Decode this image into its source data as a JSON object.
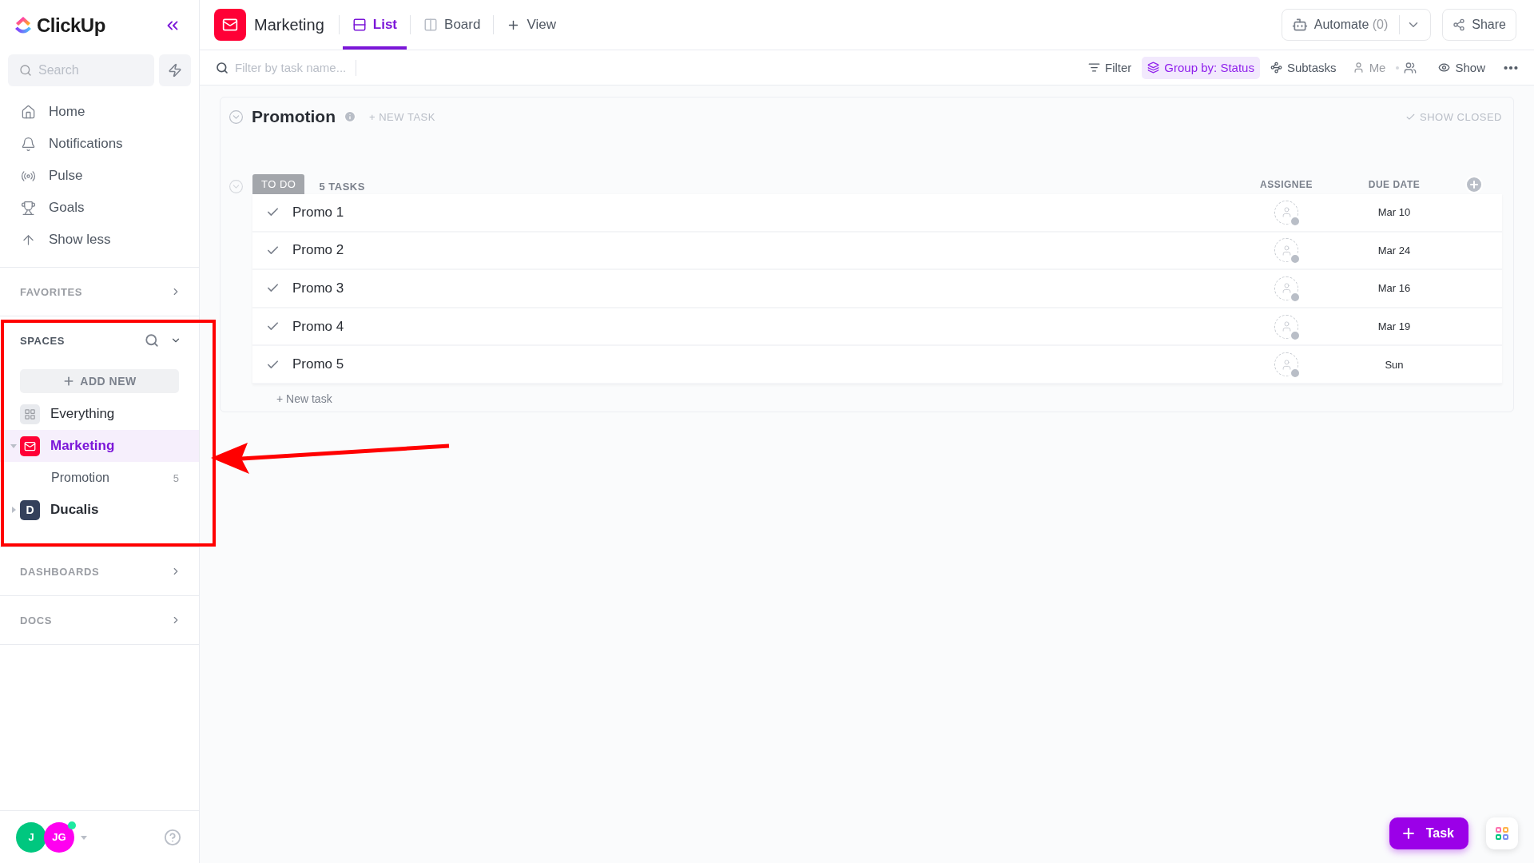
{
  "sidebar": {
    "logo": "ClickUp",
    "search": {
      "placeholder": "Search"
    },
    "nav": [
      {
        "label": "Home",
        "kind": "home"
      },
      {
        "label": "Notifications",
        "kind": "bell"
      },
      {
        "label": "Pulse",
        "kind": "pulse"
      },
      {
        "label": "Goals",
        "kind": "trophy"
      },
      {
        "label": "Show less",
        "kind": "up"
      }
    ],
    "favorites": "FAVORITES",
    "spaces": {
      "title": "SPACES",
      "add_new": "ADD NEW",
      "items": [
        {
          "label": "Everything",
          "kind": "all",
          "selected": false
        },
        {
          "label": "Marketing",
          "kind": "space",
          "selected": true,
          "expanded": true,
          "color": "#ff0036",
          "children": [
            {
              "label": "Promotion",
              "count": "5"
            }
          ]
        },
        {
          "label": "Ducalis",
          "kind": "space",
          "selected": false,
          "expanded": false,
          "color": "#34405b",
          "initial": "D"
        }
      ]
    },
    "sections": [
      {
        "label": "DASHBOARDS"
      },
      {
        "label": "DOCS"
      }
    ],
    "avatars": [
      {
        "initials": "J",
        "color": "#00c77f"
      },
      {
        "initials": "JG",
        "color": "#ff00f0",
        "online": true
      }
    ]
  },
  "header": {
    "space": "Marketing",
    "views": [
      {
        "label": "List",
        "kind": "list",
        "selected": true
      },
      {
        "label": "Board",
        "kind": "board",
        "selected": false
      }
    ],
    "add_view": "View",
    "automate": {
      "label": "Automate",
      "count": "(0)"
    },
    "share": "Share"
  },
  "toolbar": {
    "filter": {
      "placeholder": "Filter by task name..."
    },
    "items": [
      {
        "label": "Filter",
        "kind": "filter",
        "active": false
      },
      {
        "label": "Group by: Status",
        "kind": "group",
        "active": true
      },
      {
        "label": "Subtasks",
        "kind": "subtasks",
        "active": false
      },
      {
        "label": "Me",
        "kind": "me",
        "active": false
      },
      {
        "label": "Show",
        "kind": "show",
        "active": false
      }
    ]
  },
  "list": {
    "title": "Promotion",
    "new_task": "+ NEW TASK",
    "show_closed": "SHOW CLOSED",
    "group": {
      "status": "TO DO",
      "color": "#a3a6ab",
      "count": "5 TASKS"
    },
    "columns": [
      "ASSIGNEE",
      "DUE DATE"
    ],
    "tasks": [
      {
        "name": "Promo 1",
        "due": "Mar 10"
      },
      {
        "name": "Promo 2",
        "due": "Mar 24"
      },
      {
        "name": "Promo 3",
        "due": "Mar 16"
      },
      {
        "name": "Promo 4",
        "due": "Mar 19"
      },
      {
        "name": "Promo 5",
        "due": "Sun"
      }
    ],
    "add_task": "+ New task"
  },
  "fab": {
    "label": "Task"
  }
}
